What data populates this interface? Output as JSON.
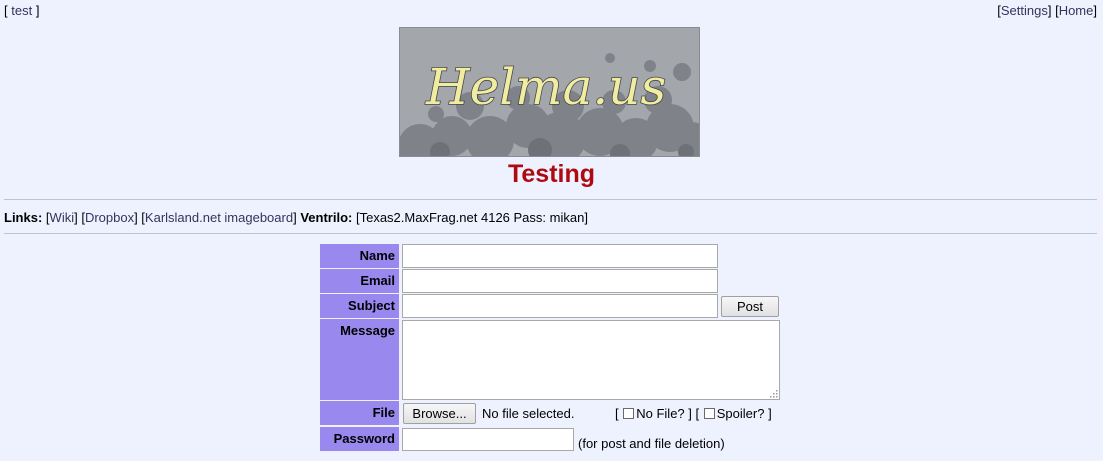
{
  "nav": {
    "left_open": "[ ",
    "left_link": "test",
    "left_close": " ]",
    "right_b1": "[",
    "settings": "Settings",
    "right_b2": "] [",
    "home": "Home",
    "right_b3": "]"
  },
  "logo": {
    "text": "Helma.us"
  },
  "board": {
    "title": "Testing"
  },
  "links": {
    "links_label": "Links:",
    "wiki": "Wiki",
    "dropbox": "Dropbox",
    "karlsland": "Karlsland.net imageboard",
    "ventrilo_label": "Ventrilo:",
    "ventrilo_value": "Texas2.MaxFrag.net 4126 Pass: mikan",
    "bracket_open": "[",
    "bracket_sep": "] [",
    "bracket_close": "]"
  },
  "form": {
    "name_label": "Name",
    "email_label": "Email",
    "subject_label": "Subject",
    "message_label": "Message",
    "file_label": "File",
    "password_label": "Password",
    "name_value": "",
    "email_value": "",
    "subject_value": "",
    "message_value": "",
    "password_value": "",
    "post_button": "Post",
    "browse_button": "Browse...",
    "no_file_text": "No file selected.",
    "no_file_option": "No File?",
    "spoiler_option": "Spoiler?",
    "opt_open": "[",
    "opt_mid": "] [",
    "opt_close": "]",
    "password_note": "(for post and file deletion)"
  },
  "colors": {
    "background": "#eef2ff",
    "label_bg": "#9988ee",
    "title": "#af0a0f",
    "link": "#34345c"
  }
}
